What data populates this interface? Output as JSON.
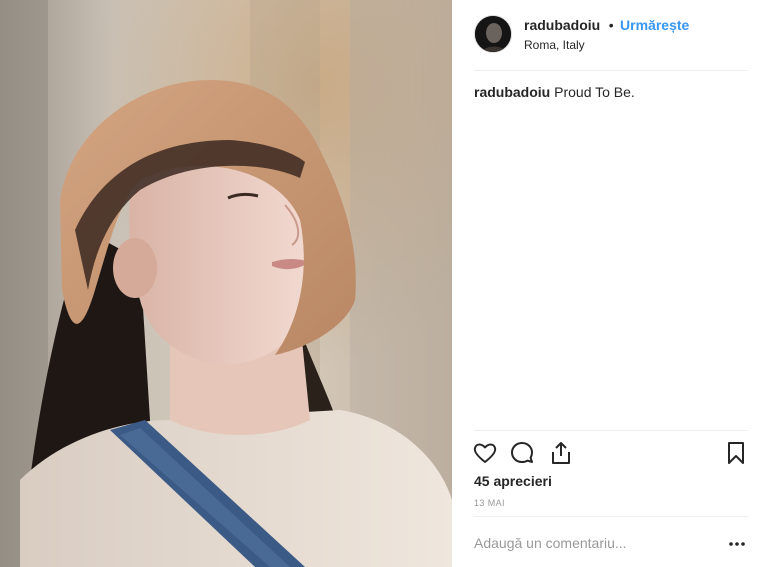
{
  "post": {
    "username": "radubadoiu",
    "separator": "•",
    "follow_label": "Urmărește",
    "location": "Roma, Italy",
    "caption_user": "radubadoiu",
    "caption_text": "Proud To Be.",
    "likes": "45 aprecieri",
    "date": "13 MAI",
    "comment_placeholder": "Adaugă un comentariu..."
  },
  "icons": {
    "like": "heart-icon",
    "comment": "comment-bubble-icon",
    "share": "share-icon",
    "save": "bookmark-icon",
    "more": "more-options-icon"
  },
  "colors": {
    "follow": "#3897f0",
    "text": "#262626",
    "muted": "#999999",
    "divider": "#efefef"
  }
}
